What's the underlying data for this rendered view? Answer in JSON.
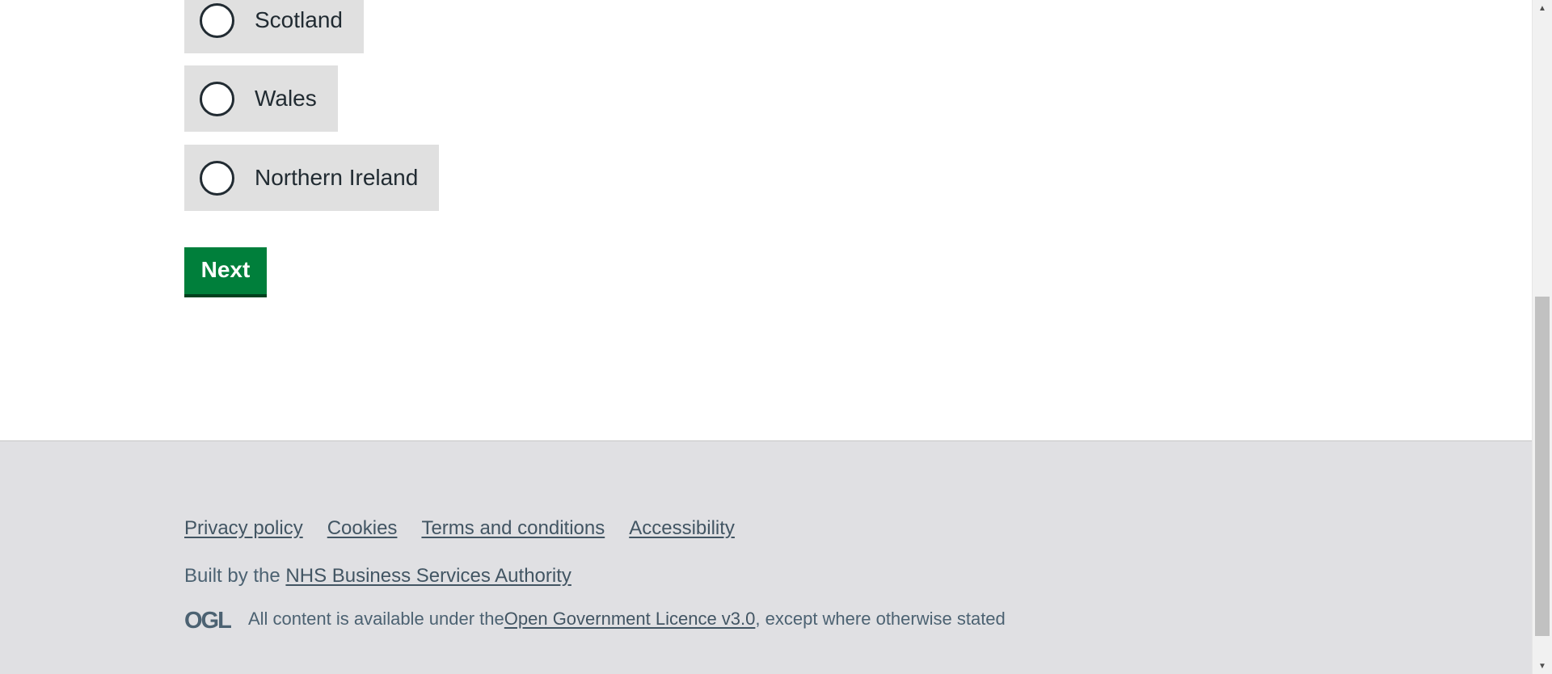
{
  "radio_options": [
    {
      "label": "Scotland"
    },
    {
      "label": "Wales"
    },
    {
      "label": "Northern Ireland"
    }
  ],
  "next_button": {
    "label": "Next"
  },
  "footer": {
    "links": [
      {
        "label": "Privacy policy"
      },
      {
        "label": "Cookies"
      },
      {
        "label": "Terms and conditions"
      },
      {
        "label": "Accessibility"
      }
    ],
    "built_by_prefix": "Built by the ",
    "built_by_link": "NHS Business Services Authority",
    "licence_prefix": "All content is available under the ",
    "licence_link": "Open Government Licence v3.0",
    "licence_suffix": ", except where otherwise stated",
    "ogl_logo_text": "OGL"
  },
  "colors": {
    "button_green": "#007f3b",
    "radio_bg": "#e0e0e0",
    "footer_bg": "#e0e0e3",
    "link": "#425563"
  },
  "icons": {
    "scroll_up": "triangle-up",
    "scroll_down": "triangle-down",
    "logo": "ogl-logo"
  }
}
